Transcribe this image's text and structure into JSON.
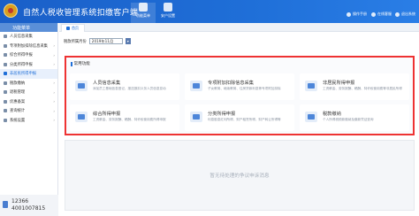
{
  "app": {
    "title": "自然人税收管理系统扣缴客户端"
  },
  "topnav": [
    {
      "label": "功能菜单",
      "icon": "menu-icon"
    },
    {
      "label": "安户设置",
      "icon": "settings-icon"
    }
  ],
  "topright": [
    {
      "label": "操作手册",
      "icon": "book-icon"
    },
    {
      "label": "在线客服",
      "icon": "service-icon"
    },
    {
      "label": "退出系统",
      "icon": "exit-icon"
    }
  ],
  "sidebar": {
    "header": "功能菜单",
    "items": [
      {
        "label": "人员信息采集",
        "icon": "people-icon"
      },
      {
        "label": "专项附加扣除信息采集",
        "icon": "form-icon",
        "arrow": "›"
      },
      {
        "label": "综合所得申报",
        "icon": "doc-icon",
        "arrow": "›"
      },
      {
        "label": "分类所得申报",
        "icon": "doc-icon",
        "arrow": "›"
      },
      {
        "label": "非居民所得申报",
        "icon": "globe-icon"
      },
      {
        "label": "税款缴纳",
        "icon": "tax-icon",
        "arrow": "›"
      },
      {
        "label": "退税管理",
        "icon": "refund-icon",
        "arrow": "›"
      },
      {
        "label": "优惠备案",
        "icon": "badge-icon",
        "arrow": "›"
      },
      {
        "label": "查询统计",
        "icon": "chart-icon",
        "arrow": "›"
      },
      {
        "label": "系统设置",
        "icon": "gear-icon",
        "arrow": "›"
      }
    ],
    "hotline": {
      "line1": "12366",
      "line2": "4001007815"
    }
  },
  "tabs": {
    "home": "首页"
  },
  "period": {
    "label": "税款所属月份",
    "value": "2019年11月",
    "button": "▾"
  },
  "panel": {
    "title": "常用功能",
    "cards": [
      {
        "title": "人员信息采集",
        "desc": "添加员工基础信息登记，报送报扣义务人员信息变动",
        "icon": "people-card-icon"
      },
      {
        "title": "专项附加扣除信息采集",
        "desc": "子女教育、继续教育、住房贷款利息等专项附加扣除",
        "icon": "form-card-icon"
      },
      {
        "title": "非居民所得申报",
        "desc": "工资薪金、劳务报酬、稿酬、特许权使用费等非居民所得",
        "icon": "globe-card-icon"
      },
      {
        "title": "综合所得申报",
        "desc": "工资薪金、劳务报酬、稿酬、特许权使用费所得申报",
        "icon": "doc-card-icon"
      },
      {
        "title": "分类所得申报",
        "desc": "利息股息红利所得、财产租赁所得、财产转让所得等",
        "icon": "list-card-icon"
      },
      {
        "title": "税款缴纳",
        "desc": "个人所得税税款缴纳及缴款凭证查询",
        "icon": "tax-card-icon"
      }
    ]
  },
  "lower": {
    "empty_message": "暂无待处理的争议申诉消息"
  }
}
